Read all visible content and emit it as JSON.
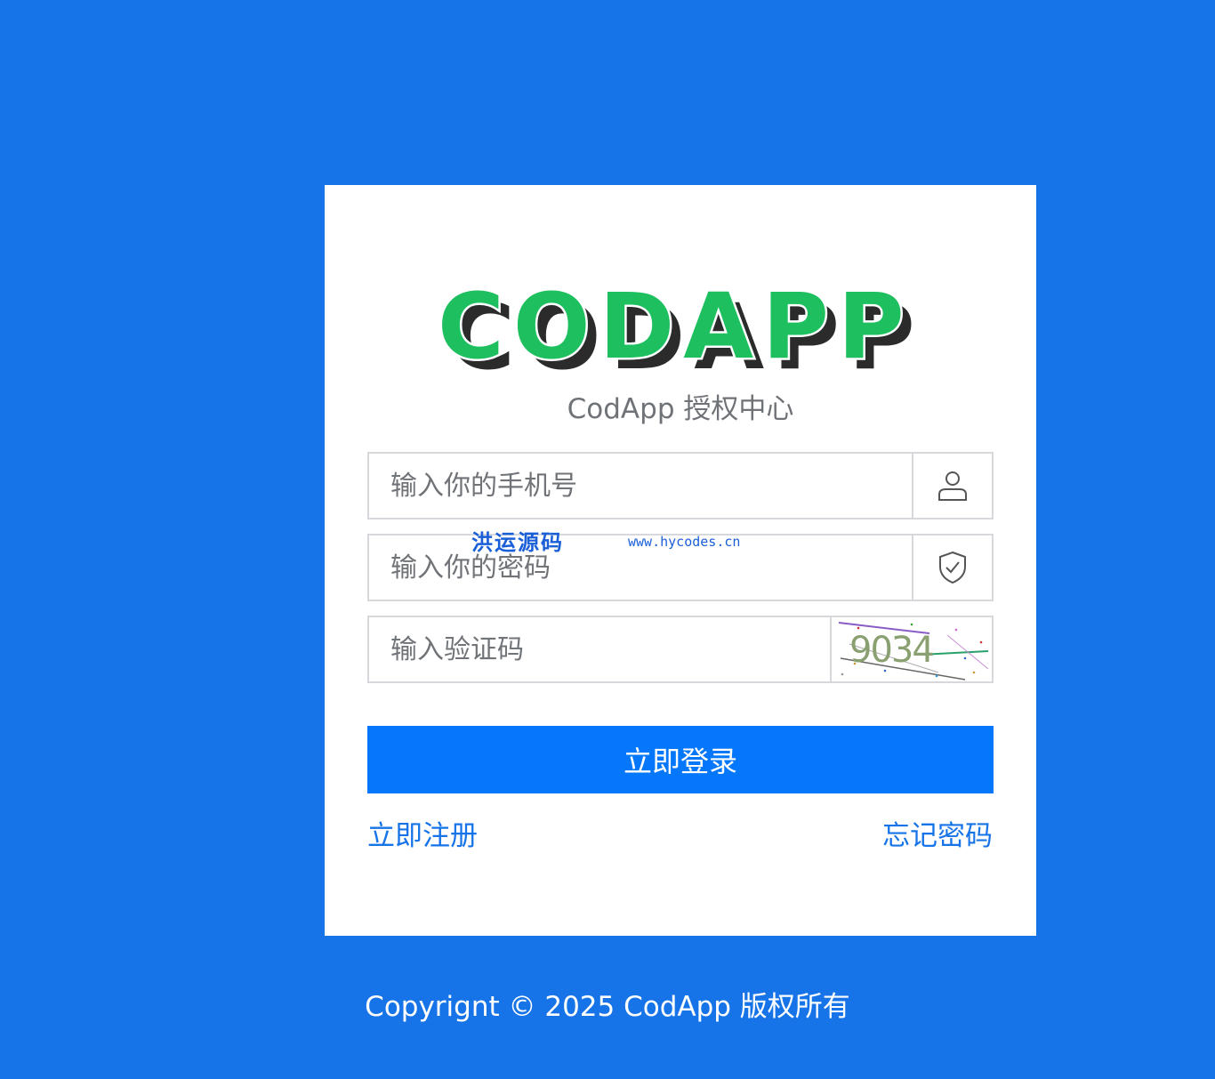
{
  "brand": {
    "logo_text": "CODAPP",
    "subtitle": "CodApp 授权中心",
    "logo_fill": "#1dbf5f",
    "logo_shadow": "#2b2b2b"
  },
  "form": {
    "phone_placeholder": "输入你的手机号",
    "password_placeholder": "输入你的密码",
    "captcha_placeholder": "输入验证码",
    "captcha_text": "9034",
    "phone_icon": "user-icon",
    "password_icon": "shield-check-icon"
  },
  "actions": {
    "login_label": "立即登录",
    "register_label": "立即注册",
    "forgot_label": "忘记密码"
  },
  "watermark": {
    "text_cn": "洪运源码",
    "text_url": "www.hycodes.cn"
  },
  "footer": {
    "copyright": "Copyrignt © 2025 CodApp 版权所有"
  },
  "colors": {
    "background": "#1774e8",
    "primary_button": "#0577fa",
    "link": "#1774e8"
  }
}
